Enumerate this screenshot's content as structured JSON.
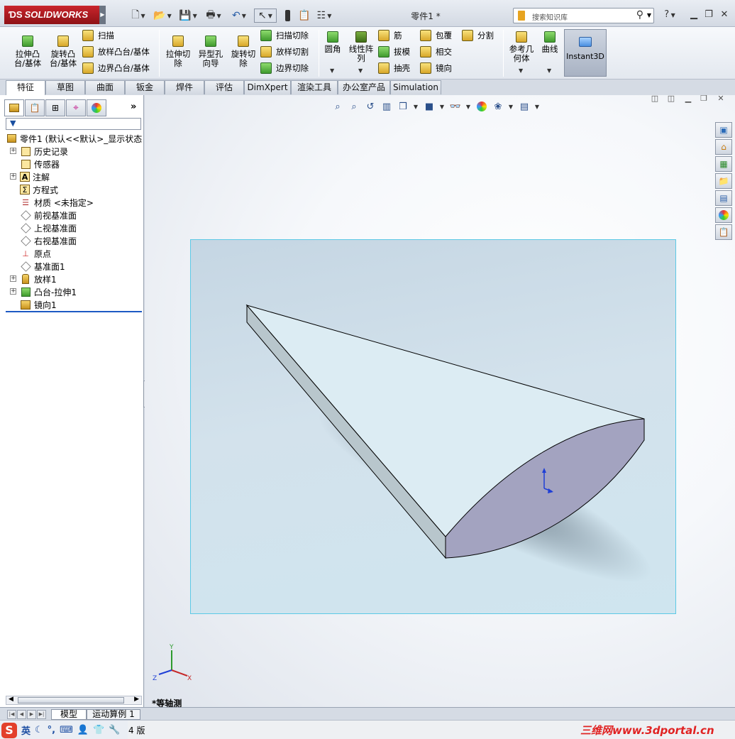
{
  "app": {
    "brand": "SOLIDWORKS",
    "document_title": "零件1 *"
  },
  "search": {
    "placeholder": "搜索知识库"
  },
  "ribbon": {
    "extrude_boss": "拉伸凸\n台/基体",
    "revolve_boss": "旋转凸\n台/基体",
    "sweep": "扫描",
    "loft_boss": "放样凸台/基体",
    "boundary_boss": "边界凸台/基体",
    "extrude_cut": "拉伸切\n除",
    "hole_wizard": "异型孔\n向导",
    "revolve_cut": "旋转切\n除",
    "sweep_cut": "扫描切除",
    "loft_cut": "放样切割",
    "boundary_cut": "边界切除",
    "fillet": "圆角",
    "linear_pattern": "线性阵\n列",
    "rib": "筋",
    "draft": "拔模",
    "shell": "抽壳",
    "wrap": "包覆",
    "intersect": "相交",
    "mirror": "镜向",
    "split": "分割",
    "ref_geometry": "参考几\n何体",
    "curves": "曲线",
    "instant3d": "Instant3D"
  },
  "tabs": [
    "特征",
    "草图",
    "曲面",
    "钣金",
    "焊件",
    "评估",
    "DimXpert",
    "渲染工具",
    "办公室产品",
    "Simulation"
  ],
  "feature_tree": {
    "root": "零件1  (默认<<默认>_显示状态",
    "items": [
      {
        "label": "历史记录",
        "expandable": true
      },
      {
        "label": "传感器",
        "expandable": false
      },
      {
        "label": "注解",
        "expandable": true
      },
      {
        "label": "方程式",
        "expandable": false
      },
      {
        "label": "材质 <未指定>",
        "expandable": false
      },
      {
        "label": "前视基准面",
        "expandable": false
      },
      {
        "label": "上视基准面",
        "expandable": false
      },
      {
        "label": "右视基准面",
        "expandable": false
      },
      {
        "label": "原点",
        "expandable": false
      },
      {
        "label": "基准面1",
        "expandable": false
      },
      {
        "label": "放样1",
        "expandable": true
      },
      {
        "label": "凸台-拉伸1",
        "expandable": true
      },
      {
        "label": "镜向1",
        "expandable": false
      }
    ]
  },
  "viewport": {
    "view_label": "*等轴测",
    "triad": {
      "x": "X",
      "y": "Y",
      "z": "Z"
    }
  },
  "bottom_tabs": [
    "模型",
    "运动算例 1"
  ],
  "status": {
    "ime_lang": "英",
    "version_text": "4 版",
    "watermark": "三维网www.3dportal.cn"
  },
  "colors": {
    "end_face": "#a3a3c0",
    "top_face": "#dcecf3",
    "side_face": "#b8c6cc",
    "plane_border": "#5cc9e6"
  }
}
